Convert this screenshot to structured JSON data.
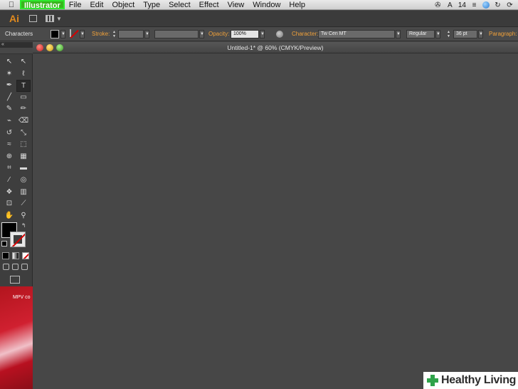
{
  "menubar": {
    "apple": "",
    "app_name": "Illustrator",
    "items": [
      "File",
      "Edit",
      "Object",
      "Type",
      "Select",
      "Effect",
      "View",
      "Window",
      "Help"
    ],
    "status": {
      "fan": "✇",
      "adobe": "A",
      "count": "14",
      "sync": "↻",
      "refresh": "⟳"
    }
  },
  "appbar": {
    "logo": "Ai"
  },
  "controlbar": {
    "panel_name": "Characters",
    "stroke_label": "Stroke:",
    "opacity_label": "Opacity:",
    "opacity_value": "100%",
    "character_label": "Character:",
    "font_family": "Tw Cen MT",
    "font_style": "Regular",
    "font_size": "36 pt",
    "paragraph_label": "Paragraph:"
  },
  "toolpanel": {
    "header": "«",
    "tools": [
      {
        "name": "selection-tool",
        "glyph": "↖"
      },
      {
        "name": "direct-selection-tool",
        "glyph": "↖"
      },
      {
        "name": "magic-wand-tool",
        "glyph": "✶"
      },
      {
        "name": "lasso-tool",
        "glyph": "ℓ"
      },
      {
        "name": "pen-tool",
        "glyph": "✒"
      },
      {
        "name": "type-tool",
        "glyph": "T"
      },
      {
        "name": "line-segment-tool",
        "glyph": "╱"
      },
      {
        "name": "rectangle-tool",
        "glyph": "▭"
      },
      {
        "name": "paintbrush-tool",
        "glyph": "✎"
      },
      {
        "name": "pencil-tool",
        "glyph": "✏"
      },
      {
        "name": "blob-brush-tool",
        "glyph": "⌁"
      },
      {
        "name": "eraser-tool",
        "glyph": "⌫"
      },
      {
        "name": "rotate-tool",
        "glyph": "↺"
      },
      {
        "name": "scale-tool",
        "glyph": "⤡"
      },
      {
        "name": "warp-tool",
        "glyph": "≈"
      },
      {
        "name": "free-transform-tool",
        "glyph": "⬚"
      },
      {
        "name": "shape-builder-tool",
        "glyph": "⊕"
      },
      {
        "name": "perspective-grid-tool",
        "glyph": "▦"
      },
      {
        "name": "mesh-tool",
        "glyph": "⌗"
      },
      {
        "name": "gradient-tool",
        "glyph": "▬"
      },
      {
        "name": "eyedropper-tool",
        "glyph": "⁄"
      },
      {
        "name": "blend-tool",
        "glyph": "◎"
      },
      {
        "name": "symbol-sprayer-tool",
        "glyph": "❖"
      },
      {
        "name": "column-graph-tool",
        "glyph": "▥"
      },
      {
        "name": "artboard-tool",
        "glyph": "⊡"
      },
      {
        "name": "slice-tool",
        "glyph": "⟋"
      },
      {
        "name": "hand-tool",
        "glyph": "✋"
      },
      {
        "name": "zoom-tool",
        "glyph": "⚲"
      }
    ],
    "swap_glyph": "↰"
  },
  "desktop": {
    "text": "MPV co"
  },
  "document": {
    "title": "Untitled-1* @ 60% (CMYK/Preview)"
  },
  "watermark": {
    "text": "Healthy Living"
  }
}
